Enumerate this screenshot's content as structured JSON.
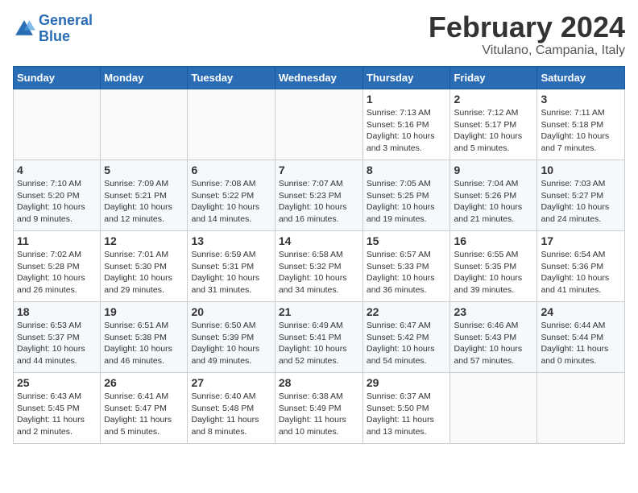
{
  "logo": {
    "line1": "General",
    "line2": "Blue"
  },
  "title": "February 2024",
  "subtitle": "Vitulano, Campania, Italy",
  "headers": [
    "Sunday",
    "Monday",
    "Tuesday",
    "Wednesday",
    "Thursday",
    "Friday",
    "Saturday"
  ],
  "weeks": [
    [
      {
        "day": "",
        "sunrise": "",
        "sunset": "",
        "daylight": ""
      },
      {
        "day": "",
        "sunrise": "",
        "sunset": "",
        "daylight": ""
      },
      {
        "day": "",
        "sunrise": "",
        "sunset": "",
        "daylight": ""
      },
      {
        "day": "",
        "sunrise": "",
        "sunset": "",
        "daylight": ""
      },
      {
        "day": "1",
        "sunrise": "Sunrise: 7:13 AM",
        "sunset": "Sunset: 5:16 PM",
        "daylight": "Daylight: 10 hours and 3 minutes."
      },
      {
        "day": "2",
        "sunrise": "Sunrise: 7:12 AM",
        "sunset": "Sunset: 5:17 PM",
        "daylight": "Daylight: 10 hours and 5 minutes."
      },
      {
        "day": "3",
        "sunrise": "Sunrise: 7:11 AM",
        "sunset": "Sunset: 5:18 PM",
        "daylight": "Daylight: 10 hours and 7 minutes."
      }
    ],
    [
      {
        "day": "4",
        "sunrise": "Sunrise: 7:10 AM",
        "sunset": "Sunset: 5:20 PM",
        "daylight": "Daylight: 10 hours and 9 minutes."
      },
      {
        "day": "5",
        "sunrise": "Sunrise: 7:09 AM",
        "sunset": "Sunset: 5:21 PM",
        "daylight": "Daylight: 10 hours and 12 minutes."
      },
      {
        "day": "6",
        "sunrise": "Sunrise: 7:08 AM",
        "sunset": "Sunset: 5:22 PM",
        "daylight": "Daylight: 10 hours and 14 minutes."
      },
      {
        "day": "7",
        "sunrise": "Sunrise: 7:07 AM",
        "sunset": "Sunset: 5:23 PM",
        "daylight": "Daylight: 10 hours and 16 minutes."
      },
      {
        "day": "8",
        "sunrise": "Sunrise: 7:05 AM",
        "sunset": "Sunset: 5:25 PM",
        "daylight": "Daylight: 10 hours and 19 minutes."
      },
      {
        "day": "9",
        "sunrise": "Sunrise: 7:04 AM",
        "sunset": "Sunset: 5:26 PM",
        "daylight": "Daylight: 10 hours and 21 minutes."
      },
      {
        "day": "10",
        "sunrise": "Sunrise: 7:03 AM",
        "sunset": "Sunset: 5:27 PM",
        "daylight": "Daylight: 10 hours and 24 minutes."
      }
    ],
    [
      {
        "day": "11",
        "sunrise": "Sunrise: 7:02 AM",
        "sunset": "Sunset: 5:28 PM",
        "daylight": "Daylight: 10 hours and 26 minutes."
      },
      {
        "day": "12",
        "sunrise": "Sunrise: 7:01 AM",
        "sunset": "Sunset: 5:30 PM",
        "daylight": "Daylight: 10 hours and 29 minutes."
      },
      {
        "day": "13",
        "sunrise": "Sunrise: 6:59 AM",
        "sunset": "Sunset: 5:31 PM",
        "daylight": "Daylight: 10 hours and 31 minutes."
      },
      {
        "day": "14",
        "sunrise": "Sunrise: 6:58 AM",
        "sunset": "Sunset: 5:32 PM",
        "daylight": "Daylight: 10 hours and 34 minutes."
      },
      {
        "day": "15",
        "sunrise": "Sunrise: 6:57 AM",
        "sunset": "Sunset: 5:33 PM",
        "daylight": "Daylight: 10 hours and 36 minutes."
      },
      {
        "day": "16",
        "sunrise": "Sunrise: 6:55 AM",
        "sunset": "Sunset: 5:35 PM",
        "daylight": "Daylight: 10 hours and 39 minutes."
      },
      {
        "day": "17",
        "sunrise": "Sunrise: 6:54 AM",
        "sunset": "Sunset: 5:36 PM",
        "daylight": "Daylight: 10 hours and 41 minutes."
      }
    ],
    [
      {
        "day": "18",
        "sunrise": "Sunrise: 6:53 AM",
        "sunset": "Sunset: 5:37 PM",
        "daylight": "Daylight: 10 hours and 44 minutes."
      },
      {
        "day": "19",
        "sunrise": "Sunrise: 6:51 AM",
        "sunset": "Sunset: 5:38 PM",
        "daylight": "Daylight: 10 hours and 46 minutes."
      },
      {
        "day": "20",
        "sunrise": "Sunrise: 6:50 AM",
        "sunset": "Sunset: 5:39 PM",
        "daylight": "Daylight: 10 hours and 49 minutes."
      },
      {
        "day": "21",
        "sunrise": "Sunrise: 6:49 AM",
        "sunset": "Sunset: 5:41 PM",
        "daylight": "Daylight: 10 hours and 52 minutes."
      },
      {
        "day": "22",
        "sunrise": "Sunrise: 6:47 AM",
        "sunset": "Sunset: 5:42 PM",
        "daylight": "Daylight: 10 hours and 54 minutes."
      },
      {
        "day": "23",
        "sunrise": "Sunrise: 6:46 AM",
        "sunset": "Sunset: 5:43 PM",
        "daylight": "Daylight: 10 hours and 57 minutes."
      },
      {
        "day": "24",
        "sunrise": "Sunrise: 6:44 AM",
        "sunset": "Sunset: 5:44 PM",
        "daylight": "Daylight: 11 hours and 0 minutes."
      }
    ],
    [
      {
        "day": "25",
        "sunrise": "Sunrise: 6:43 AM",
        "sunset": "Sunset: 5:45 PM",
        "daylight": "Daylight: 11 hours and 2 minutes."
      },
      {
        "day": "26",
        "sunrise": "Sunrise: 6:41 AM",
        "sunset": "Sunset: 5:47 PM",
        "daylight": "Daylight: 11 hours and 5 minutes."
      },
      {
        "day": "27",
        "sunrise": "Sunrise: 6:40 AM",
        "sunset": "Sunset: 5:48 PM",
        "daylight": "Daylight: 11 hours and 8 minutes."
      },
      {
        "day": "28",
        "sunrise": "Sunrise: 6:38 AM",
        "sunset": "Sunset: 5:49 PM",
        "daylight": "Daylight: 11 hours and 10 minutes."
      },
      {
        "day": "29",
        "sunrise": "Sunrise: 6:37 AM",
        "sunset": "Sunset: 5:50 PM",
        "daylight": "Daylight: 11 hours and 13 minutes."
      },
      {
        "day": "",
        "sunrise": "",
        "sunset": "",
        "daylight": ""
      },
      {
        "day": "",
        "sunrise": "",
        "sunset": "",
        "daylight": ""
      }
    ]
  ]
}
